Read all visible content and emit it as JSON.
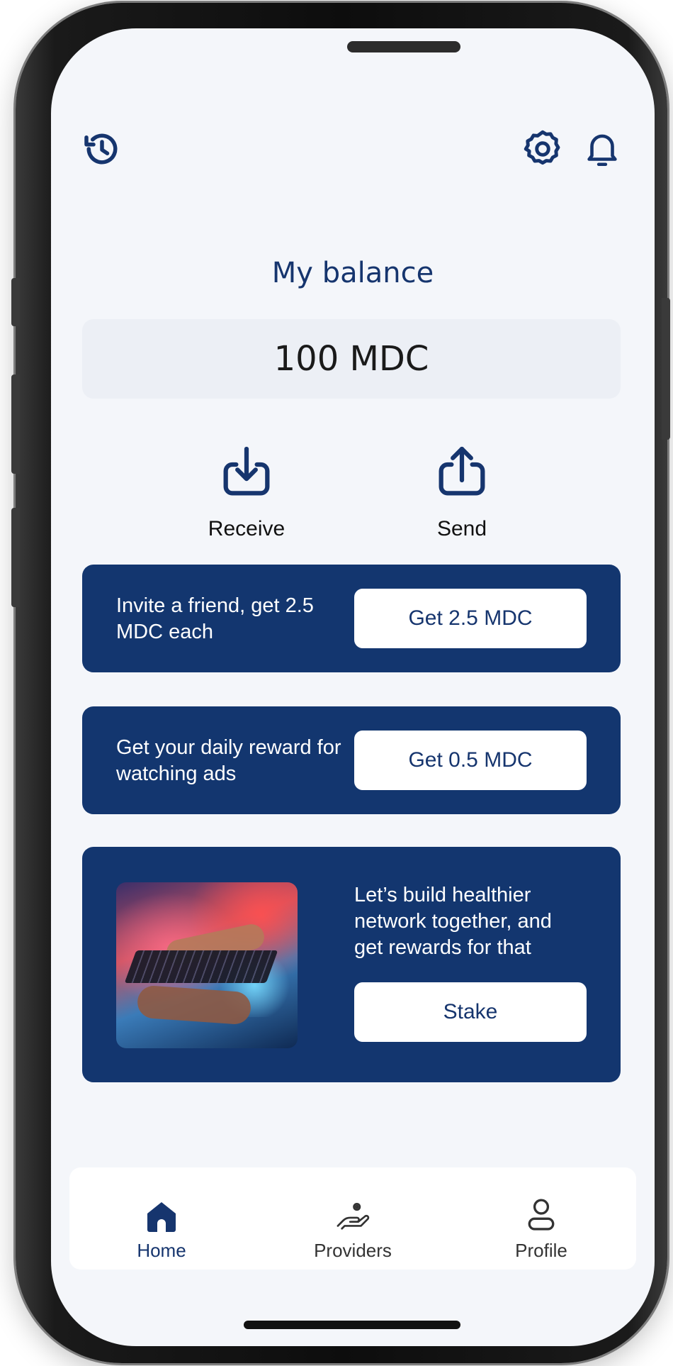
{
  "header": {
    "history_icon": "history-icon",
    "settings_icon": "settings-gear-icon",
    "bell_icon": "bell-icon"
  },
  "balance": {
    "title": "My balance",
    "amount": "100 MDC"
  },
  "actions": {
    "receive": {
      "label": "Receive",
      "icon": "download-tray-icon"
    },
    "send": {
      "label": "Send",
      "icon": "upload-tray-icon"
    }
  },
  "promos": {
    "invite": {
      "text": "Invite a friend, get 2.5 MDC each",
      "button": "Get 2.5 MDC"
    },
    "daily": {
      "text": "Get your daily reward for watching ads",
      "button": "Get 0.5 MDC"
    },
    "stake": {
      "text": "Let’s build healthier network together, and get rewards for that",
      "button": "Stake"
    }
  },
  "nav": {
    "home": {
      "label": "Home",
      "icon": "home-icon",
      "active": true
    },
    "providers": {
      "label": "Providers",
      "icon": "hand-gear-icon"
    },
    "profile": {
      "label": "Profile",
      "icon": "person-icon"
    }
  },
  "colors": {
    "accent": "#16356e",
    "card": "#13366f",
    "background": "#f4f6fa"
  }
}
